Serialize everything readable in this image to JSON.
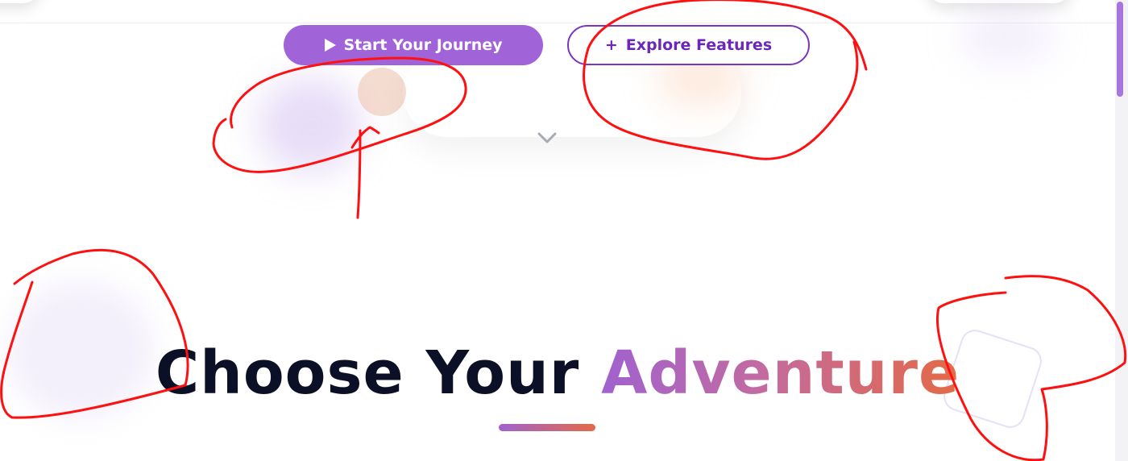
{
  "hero": {
    "primary_button_label": "Start Your Journey",
    "secondary_button_label": "Explore Features",
    "secondary_button_prefix": "+"
  },
  "section": {
    "heading_plain": "Choose Your",
    "heading_highlight": "Adventure"
  },
  "icons": {
    "primary_button_icon": "play-icon",
    "secondary_button_icon": "plus-icon",
    "scroll_indicator": "chevron-down-icon"
  },
  "colors": {
    "primary_button_bg": "#a064d8",
    "secondary_button_text": "#6b27b8",
    "heading_text": "#0c1026",
    "gradient_start": "#a062cf",
    "gradient_end": "#e36a46",
    "annotation_ink": "#ff0000"
  }
}
